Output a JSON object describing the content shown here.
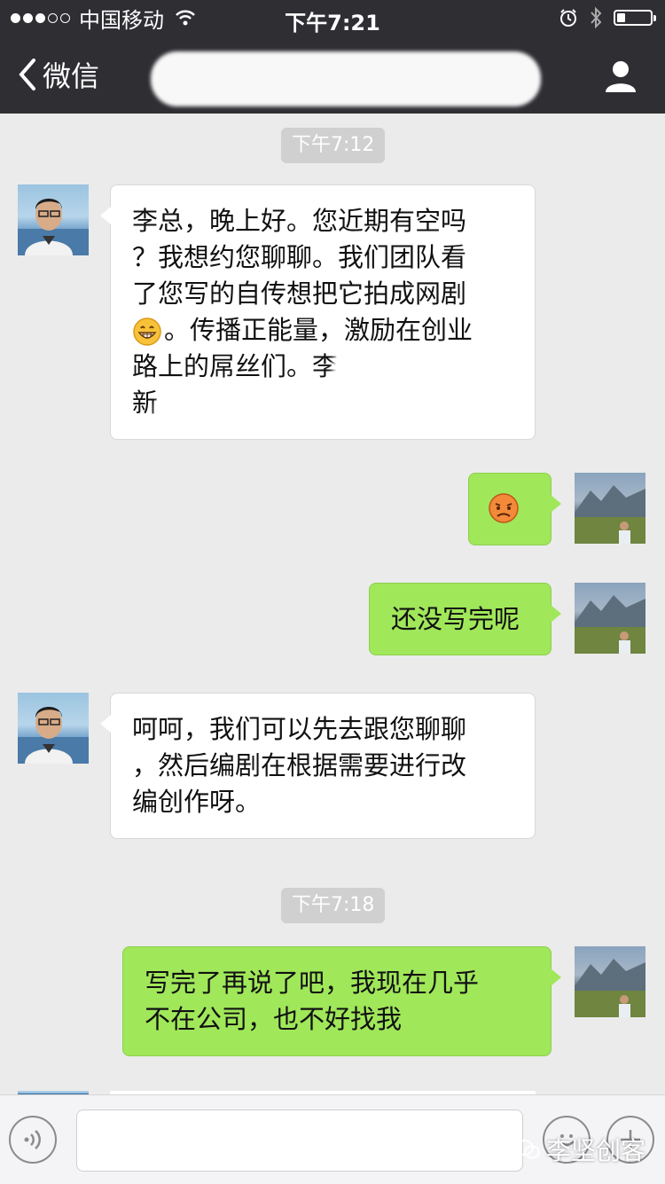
{
  "status_bar": {
    "carrier": "中国移动",
    "time": "下午7:21"
  },
  "nav": {
    "back_label": "微信",
    "title": "",
    "icons": {
      "back": "chevron-left-icon",
      "profile": "person-icon"
    }
  },
  "messages": [
    {
      "type": "timestamp",
      "text": "下午7:12"
    },
    {
      "type": "incoming",
      "lines": [
        "李总，晚上好。您近期有空吗",
        "？我想约您聊聊。我们团队看",
        "了您写的自传想把它拍成网剧",
        "。传播正能量，激励在创业",
        "路上的屌丝们。李",
        "新"
      ],
      "emoji": "grin-emoji"
    },
    {
      "type": "outgoing",
      "emoji": "embarrassed-emoji"
    },
    {
      "type": "outgoing",
      "text": "还没写完呢"
    },
    {
      "type": "incoming",
      "lines": [
        "呵呵，我们可以先去跟您聊聊",
        "，然后编剧在根据需要进行改",
        "编创作呀。"
      ]
    },
    {
      "type": "timestamp",
      "text": "下午7:18"
    },
    {
      "type": "outgoing",
      "lines": [
        "写完了再说了吧，我现在几乎",
        "不在公司，也不好找我"
      ]
    }
  ],
  "input": {
    "value": "",
    "placeholder": ""
  },
  "watermark": "李坚创客",
  "colors": {
    "header": "#2e2e33",
    "chat_background": "#ebebeb",
    "outgoing_bubble": "#a0e75a",
    "incoming_bubble": "#ffffff",
    "timestamp_bg": "#d0d0d0"
  }
}
